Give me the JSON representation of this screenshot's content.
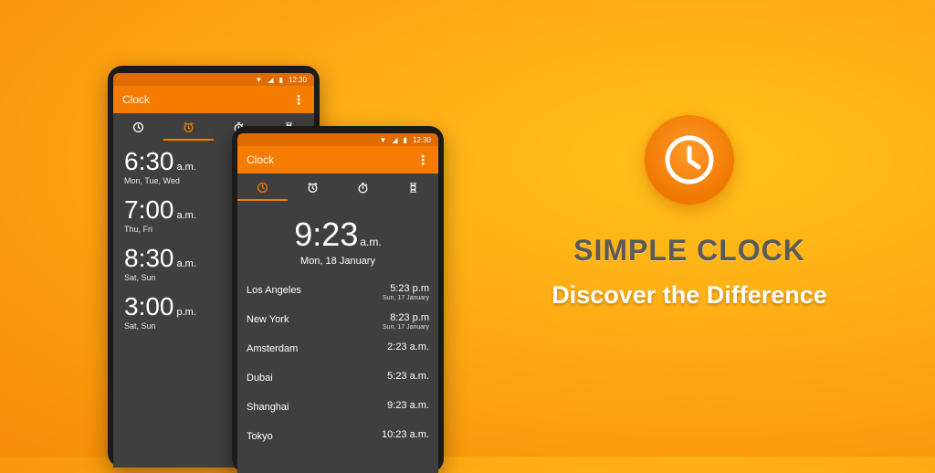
{
  "colors": {
    "accent": "#f57c00",
    "statusbar": "#e06b00",
    "screen_bg": "#3f3f3f"
  },
  "phone_back": {
    "status_time": "12:30",
    "app_title": "Clock",
    "tabs": [
      "clock-icon",
      "alarm-icon",
      "stopwatch-icon",
      "timer-icon"
    ],
    "alarms": [
      {
        "time": "6:30",
        "ampm": "a.m.",
        "days": "Mon, Tue, Wed"
      },
      {
        "time": "7:00",
        "ampm": "a.m.",
        "days": "Thu, Fri"
      },
      {
        "time": "8:30",
        "ampm": "a.m.",
        "days": "Sat, Sun"
      },
      {
        "time": "3:00",
        "ampm": "p.m.",
        "days": "Sat, Sun"
      }
    ]
  },
  "phone_front": {
    "status_time": "12:30",
    "app_title": "Clock",
    "tabs": [
      "clock-icon",
      "alarm-icon",
      "stopwatch-icon",
      "timer-icon"
    ],
    "main_time": "9:23",
    "main_ampm": "a.m.",
    "main_date": "Mon, 18 January",
    "cities": [
      {
        "name": "Los Angeles",
        "time": "5:23 p.m",
        "date": "Sun, 17 January"
      },
      {
        "name": "New York",
        "time": "8:23 p.m",
        "date": "Sun, 17 January"
      },
      {
        "name": "Amsterdam",
        "time": "2:23 a.m.",
        "date": ""
      },
      {
        "name": "Dubai",
        "time": "5:23 a.m.",
        "date": ""
      },
      {
        "name": "Shanghai",
        "time": "9:23 a.m.",
        "date": ""
      },
      {
        "name": "Tokyo",
        "time": "10:23 a.m.",
        "date": ""
      }
    ]
  },
  "hero": {
    "icon": "clock-icon",
    "title": "SIMPLE CLOCK",
    "subtitle": "Discover the Difference"
  }
}
